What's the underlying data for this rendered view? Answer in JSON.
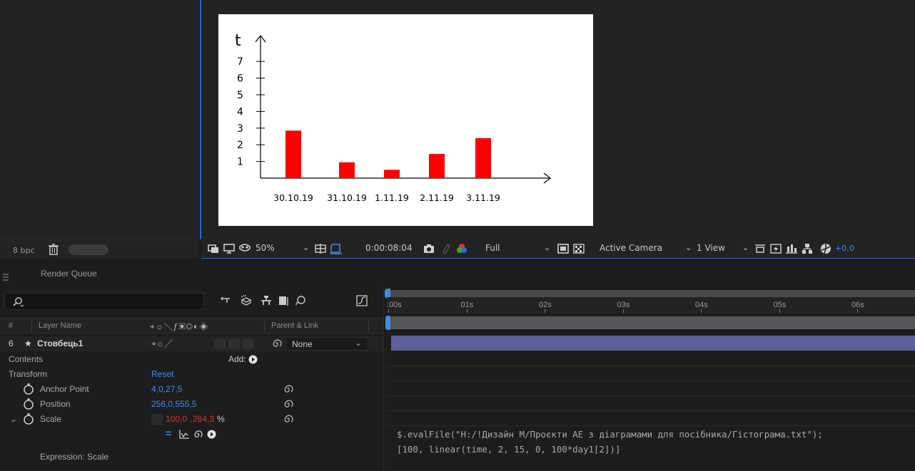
{
  "viewer": {
    "chart_data": {
      "type": "bar",
      "categories": [
        "30.10.19",
        "31.10.19",
        "1.11.19",
        "2.11.19",
        "3.11.19"
      ],
      "values": [
        2.85,
        0.95,
        0.5,
        1.45,
        2.4
      ],
      "ylabel": "t",
      "yticks": [
        "1",
        "2",
        "3",
        "4",
        "5",
        "6",
        "7"
      ],
      "ylim": [
        0,
        8
      ],
      "bar_color": "#ff0000",
      "grid": false
    }
  },
  "bpc": {
    "label": "8 bpc"
  },
  "toolbar": {
    "zoom": "50%",
    "timecode": "0:00:08:04",
    "resolution": "Full",
    "camera": "Active Camera",
    "views": "1 View",
    "exposure": "+0,0"
  },
  "panel": {
    "render_queue_tab": "Render Queue"
  },
  "columns": {
    "hash": "#",
    "layer_name": "Layer Name",
    "parent_link": "Parent & Link"
  },
  "layer": {
    "index": "6",
    "name": "Стовбець1",
    "parent": "None"
  },
  "props": {
    "contents": "Contents",
    "add_label": "Add:",
    "transform": "Transform",
    "reset": "Reset",
    "anchor_label": "Anchor Point",
    "anchor_value": "4,0,27,5",
    "position_label": "Position",
    "position_value": "256,0,555,5",
    "scale_label": "Scale",
    "scale_x": "100,0",
    "scale_sep": ",",
    "scale_y": "284,3",
    "scale_unit": "%",
    "expression_label": "Expression: Scale"
  },
  "timeline": {
    "ticks": [
      ":00s",
      "01s",
      "02s",
      "03s",
      "04s",
      "05s",
      "06s"
    ],
    "expression_line1": "$.evalFile(\"H:/!Дизайн М/Проєкти АЕ з діаграмами для посібника/Гістограма.txt\");",
    "expression_line2": "[100, linear(time, 2, 15, 0, 100*day1[2])]"
  },
  "colors": {
    "accent_blue": "#2b63c8",
    "value_blue": "#3b8de8",
    "layer_bar": "#5d609a",
    "scale_red": "#d83232"
  }
}
